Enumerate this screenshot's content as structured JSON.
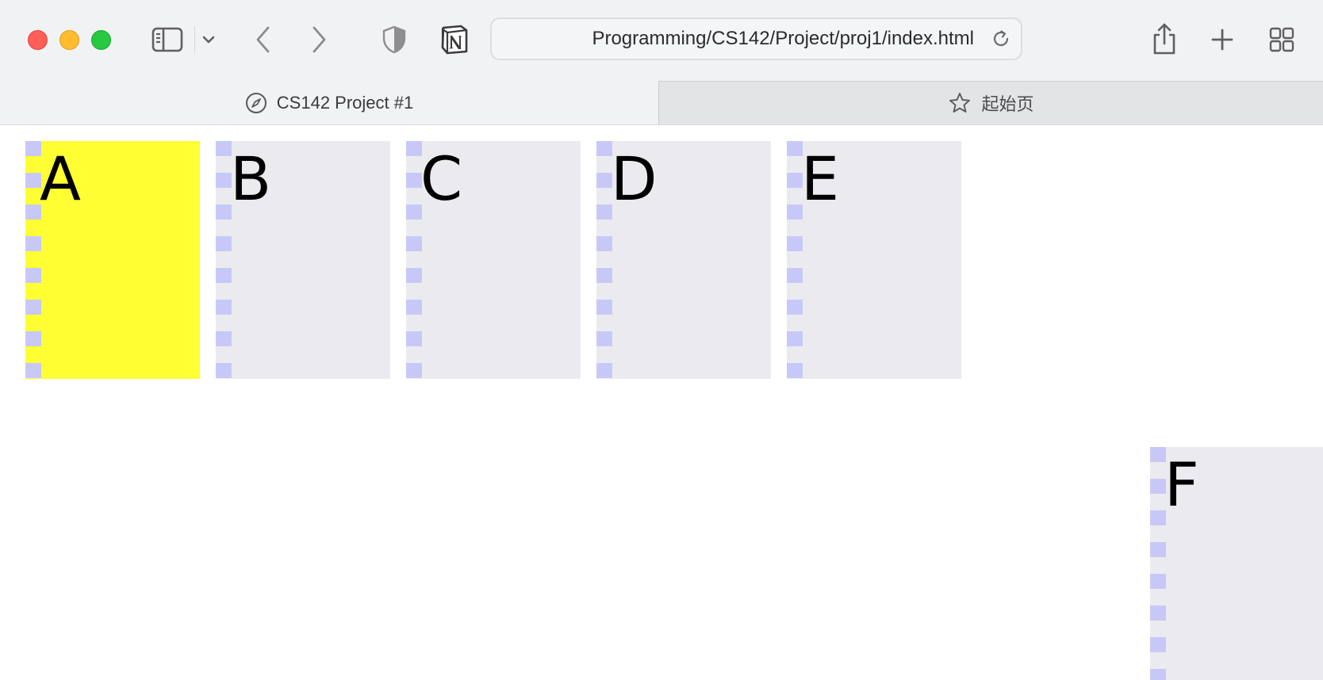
{
  "window": {
    "traffic_lights": [
      "close",
      "minimize",
      "zoom"
    ]
  },
  "toolbar": {
    "sidebar_icon": "sidebar-icon",
    "back_icon": "chevron-left-icon",
    "forward_icon": "chevron-right-icon",
    "privacy_icon": "shield-icon",
    "extension_icon": "notion-icon",
    "address": {
      "url": "Programming/CS142/Project/proj1/index.html",
      "reload_icon": "reload-icon"
    },
    "share_icon": "share-icon",
    "new_tab_icon": "plus-icon",
    "tab_overview_icon": "grid-icon"
  },
  "tabs": [
    {
      "label": "CS142 Project #1",
      "icon": "compass-icon",
      "active": true
    },
    {
      "label": "起始页",
      "icon": "star-icon",
      "active": false
    }
  ],
  "page": {
    "boxes": [
      {
        "label": "A",
        "highlighted": true
      },
      {
        "label": "B",
        "highlighted": false
      },
      {
        "label": "C",
        "highlighted": false
      },
      {
        "label": "D",
        "highlighted": false
      },
      {
        "label": "E",
        "highlighted": false
      },
      {
        "label": "F",
        "highlighted": false
      }
    ]
  },
  "colors": {
    "highlight": "#ffff33",
    "box_bg": "#ebebef",
    "stripe": "#c8c8f8"
  }
}
